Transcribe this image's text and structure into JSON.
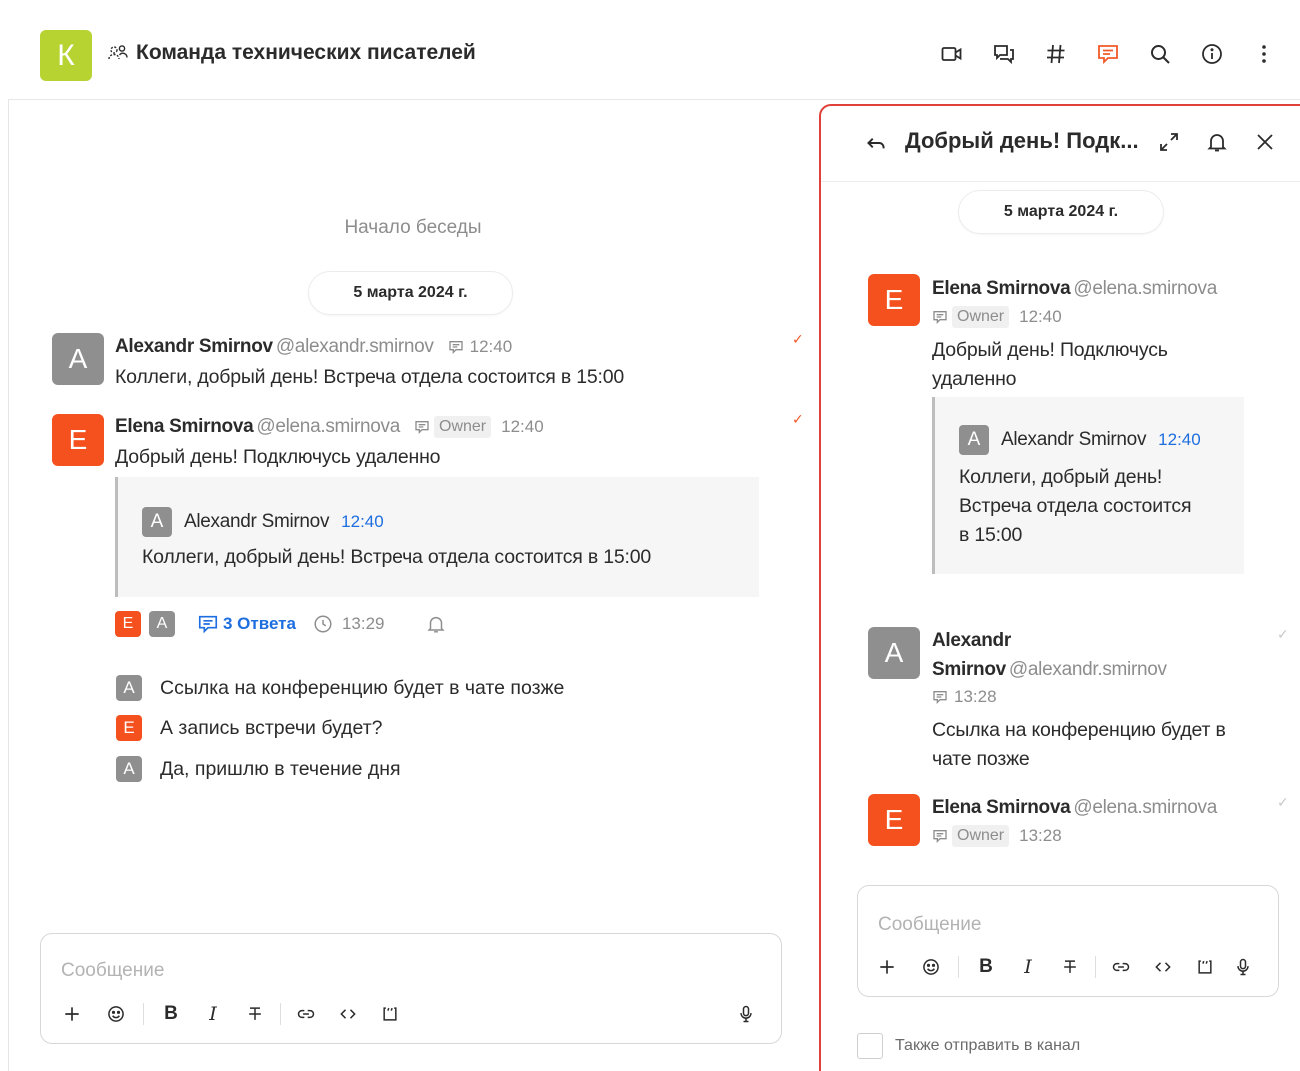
{
  "header": {
    "room_avatar_letter": "К",
    "room_avatar_color": "#b6d332",
    "title": "Команда технических писателей",
    "icons": [
      "video-call-icon",
      "discussions-icon",
      "channel-hash-icon",
      "threads-icon",
      "search-icon",
      "info-icon",
      "kebab-menu-icon"
    ],
    "active_icon": "threads-icon",
    "accent_color": "#f0592a"
  },
  "main": {
    "conversation_start": "Начало беседы",
    "date": "5 марта 2024 г.",
    "messages": [
      {
        "avatar": "A",
        "name": "Alexandr Smirnov",
        "handle": "@alexandr.smirnov",
        "time": "12:40",
        "text": "Коллеги, добрый день! Встреча отдела состоится в 15:00"
      },
      {
        "avatar": "E",
        "name": "Elena Smirnova",
        "handle": "@elena.smirnova",
        "badge": "Owner",
        "time": "12:40",
        "text": "Добрый день! Подключусь удаленно",
        "quote": {
          "avatar": "A",
          "name": "Alexandr Smirnov",
          "time": "12:40",
          "text": "Коллеги, добрый день! Встреча отдела состоится в 15:00"
        },
        "thread": {
          "participants": [
            "E",
            "A"
          ],
          "replies_label": "3 Ответа",
          "last_reply_time": "13:29"
        }
      }
    ],
    "thread_preview": [
      {
        "avatar": "A",
        "text": "Ссылка на конференцию будет в чате позже"
      },
      {
        "avatar": "E",
        "text": "А запись встречи будет?"
      },
      {
        "avatar": "A",
        "text": "Да, пришлю в течение дня"
      }
    ],
    "composer": {
      "placeholder": "Сообщение"
    }
  },
  "thread_panel": {
    "title": "Добрый день! Подк...",
    "date": "5 марта 2024 г.",
    "messages": [
      {
        "avatar": "E",
        "name": "Elena Smirnova",
        "handle": "@elena.smirnova",
        "badge": "Owner",
        "time": "12:40",
        "text_line1": "Добрый день! Подключусь",
        "text_line2": "удаленно",
        "quote": {
          "avatar": "A",
          "name": "Alexandr Smirnov",
          "time": "12:40",
          "line1": "Коллеги, добрый день!",
          "line2": "Встреча отдела состоится",
          "line3": "в 15:00"
        }
      },
      {
        "avatar": "A",
        "name_line1": "Alexandr",
        "name_line2": "Smirnov",
        "handle": "@alexandr.smirnov",
        "time": "13:28",
        "text_line1": "Ссылка на конференцию будет в",
        "text_line2": "чате позже"
      },
      {
        "avatar": "E",
        "name": "Elena Smirnova",
        "handle": "@elena.smirnova",
        "badge": "Owner",
        "time": "13:28"
      }
    ],
    "composer": {
      "placeholder": "Сообщение"
    },
    "also_send_label": "Также отправить в канал"
  },
  "colors": {
    "orange_avatar": "#f4511e",
    "gray_avatar": "#8f8f8f",
    "link_blue": "#1e6ee0",
    "thread_border": "#e0403a"
  }
}
